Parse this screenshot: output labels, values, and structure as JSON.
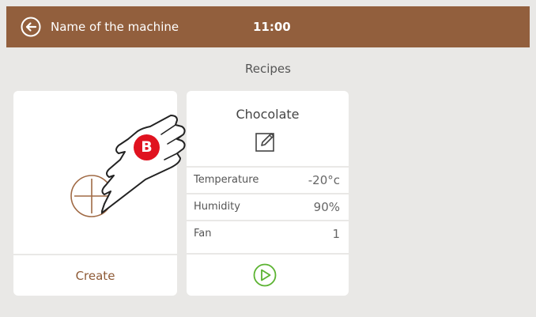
{
  "header": {
    "machine_name": "Name of the machine",
    "time": "11:00",
    "back_icon": "back-arrow-circle-icon",
    "color": "#925f3d"
  },
  "page": {
    "title": "Recipes"
  },
  "create_card": {
    "label": "Create",
    "icon": "add-circle-icon"
  },
  "recipe": {
    "name": "Chocolate",
    "edit_icon": "edit-icon",
    "params": [
      {
        "label": "Temperature",
        "value": "-20°c"
      },
      {
        "label": "Humidity",
        "value": "90%"
      },
      {
        "label": "Fan",
        "value": "1"
      }
    ],
    "play_icon": "play-circle-icon",
    "play_color": "#5bb331"
  },
  "overlay": {
    "badge": "B",
    "badge_color": "#e0121f",
    "icon": "pointing-hand-icon"
  }
}
